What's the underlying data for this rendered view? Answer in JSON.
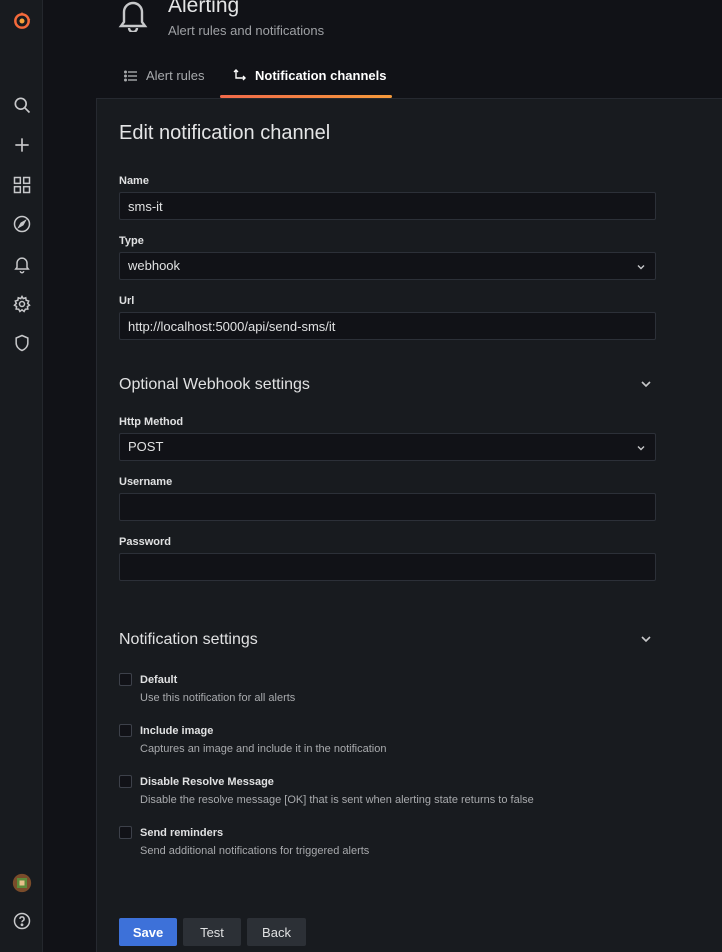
{
  "app": {
    "colors": {
      "accent": "#f46a3b",
      "primary": "#3d71d9",
      "background": "#181b1f"
    }
  },
  "sidebar": {
    "items": [
      {
        "icon": "grafana-logo-icon"
      },
      {
        "icon": "search-icon"
      },
      {
        "icon": "plus-icon"
      },
      {
        "icon": "dashboards-icon"
      },
      {
        "icon": "explore-icon"
      },
      {
        "icon": "bell-icon"
      },
      {
        "icon": "gear-icon"
      },
      {
        "icon": "shield-icon"
      },
      {
        "icon": "avatar"
      },
      {
        "icon": "help-icon"
      }
    ]
  },
  "header": {
    "title": "Alerting",
    "subtitle": "Alert rules and notifications",
    "tabs": [
      {
        "label": "Alert rules",
        "active": false
      },
      {
        "label": "Notification channels",
        "active": true
      }
    ]
  },
  "form": {
    "title": "Edit notification channel",
    "name": {
      "label": "Name",
      "value": "sms-it"
    },
    "type": {
      "label": "Type",
      "value": "webhook"
    },
    "url": {
      "label": "Url",
      "value": "http://localhost:5000/api/send-sms/it"
    },
    "webhook_section": {
      "title": "Optional Webhook settings",
      "http_method": {
        "label": "Http Method",
        "value": "POST"
      },
      "username": {
        "label": "Username",
        "value": ""
      },
      "password": {
        "label": "Password",
        "value": ""
      }
    },
    "notification_section": {
      "title": "Notification settings",
      "options": [
        {
          "label": "Default",
          "description": "Use this notification for all alerts",
          "checked": false
        },
        {
          "label": "Include image",
          "description": "Captures an image and include it in the notification",
          "checked": false
        },
        {
          "label": "Disable Resolve Message",
          "description": "Disable the resolve message [OK] that is sent when alerting state returns to false",
          "checked": false
        },
        {
          "label": "Send reminders",
          "description": "Send additional notifications for triggered alerts",
          "checked": false
        }
      ]
    },
    "buttons": {
      "save": "Save",
      "test": "Test",
      "back": "Back"
    }
  }
}
